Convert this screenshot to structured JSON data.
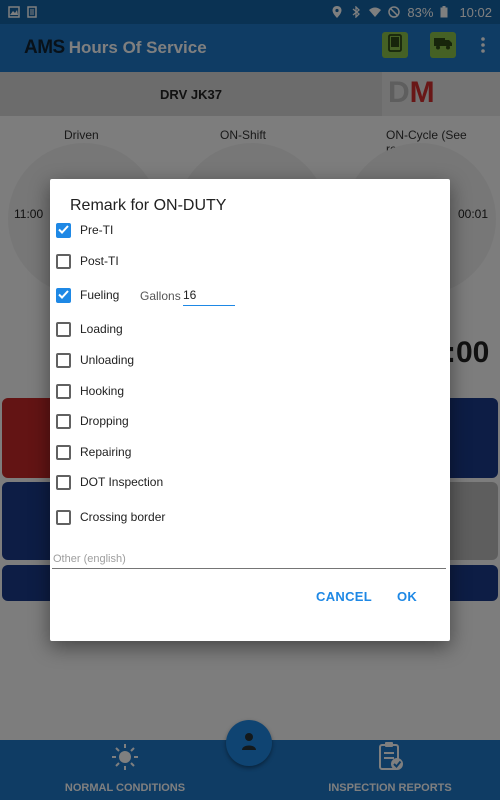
{
  "status_bar": {
    "battery": "83%",
    "time": "10:02"
  },
  "app_bar": {
    "logo": "AMS",
    "title": "Hours Of Service"
  },
  "driver_bar": {
    "driver": "DRV JK37",
    "mode_d": "D",
    "mode_m": "M"
  },
  "gauges": {
    "driven_label": "Driven",
    "driven_value": "11:00",
    "on_shift_label": "ON-Shift",
    "on_cycle_label": "ON-Cycle (See recap)",
    "on_cycle_value": "00:01",
    "big_time": ":00"
  },
  "bottom_nav": {
    "left_label": "NORMAL CONDITIONS",
    "right_label": "INSPECTION REPORTS"
  },
  "dialog": {
    "title": "Remark for ON-DUTY",
    "options": [
      {
        "label": "Pre-TI",
        "checked": true
      },
      {
        "label": "Post-TI",
        "checked": false
      },
      {
        "label": "Fueling",
        "checked": true
      },
      {
        "label": "Loading",
        "checked": false
      },
      {
        "label": "Unloading",
        "checked": false
      },
      {
        "label": "Hooking",
        "checked": false
      },
      {
        "label": "Dropping",
        "checked": false
      },
      {
        "label": "Repairing",
        "checked": false
      },
      {
        "label": "DOT Inspection",
        "checked": false
      },
      {
        "label": "Crossing border",
        "checked": false
      }
    ],
    "gallons_label": "Gallons",
    "gallons_value": "16",
    "other_placeholder": "Other (english)",
    "cancel_label": "CANCEL",
    "ok_label": "OK"
  },
  "colors": {
    "primary": "#1e78c8",
    "accent": "#1e88e5",
    "red": "#d32f2f",
    "green": "#8bc34a"
  }
}
